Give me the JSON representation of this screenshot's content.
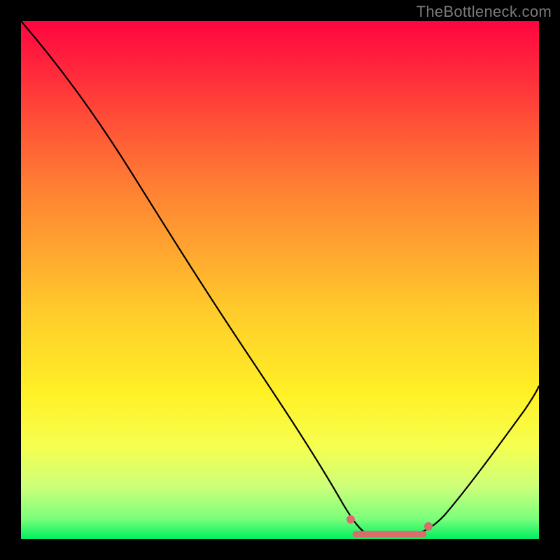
{
  "watermark": "TheBottleneck.com",
  "chart_data": {
    "type": "line",
    "title": "",
    "xlabel": "",
    "ylabel": "",
    "xlim": [
      0,
      100
    ],
    "ylim": [
      0,
      100
    ],
    "grid": false,
    "legend": false,
    "series": [
      {
        "name": "bottleneck-curve",
        "x": [
          0,
          5,
          10,
          15,
          20,
          25,
          30,
          35,
          40,
          45,
          50,
          55,
          60,
          62,
          65,
          70,
          75,
          80,
          85,
          90,
          95,
          100
        ],
        "y": [
          100,
          93,
          86,
          79,
          72,
          65,
          57,
          50,
          42,
          34,
          26,
          18,
          10,
          5,
          2,
          1,
          1,
          2,
          8,
          16,
          25,
          35
        ]
      }
    ],
    "highlight": {
      "name": "optimal-range",
      "x_start": 62,
      "x_end": 80,
      "y": 1.5,
      "color": "#d96c6c"
    },
    "background_gradient": [
      "#ff0540",
      "#fff126",
      "#00f060"
    ]
  }
}
